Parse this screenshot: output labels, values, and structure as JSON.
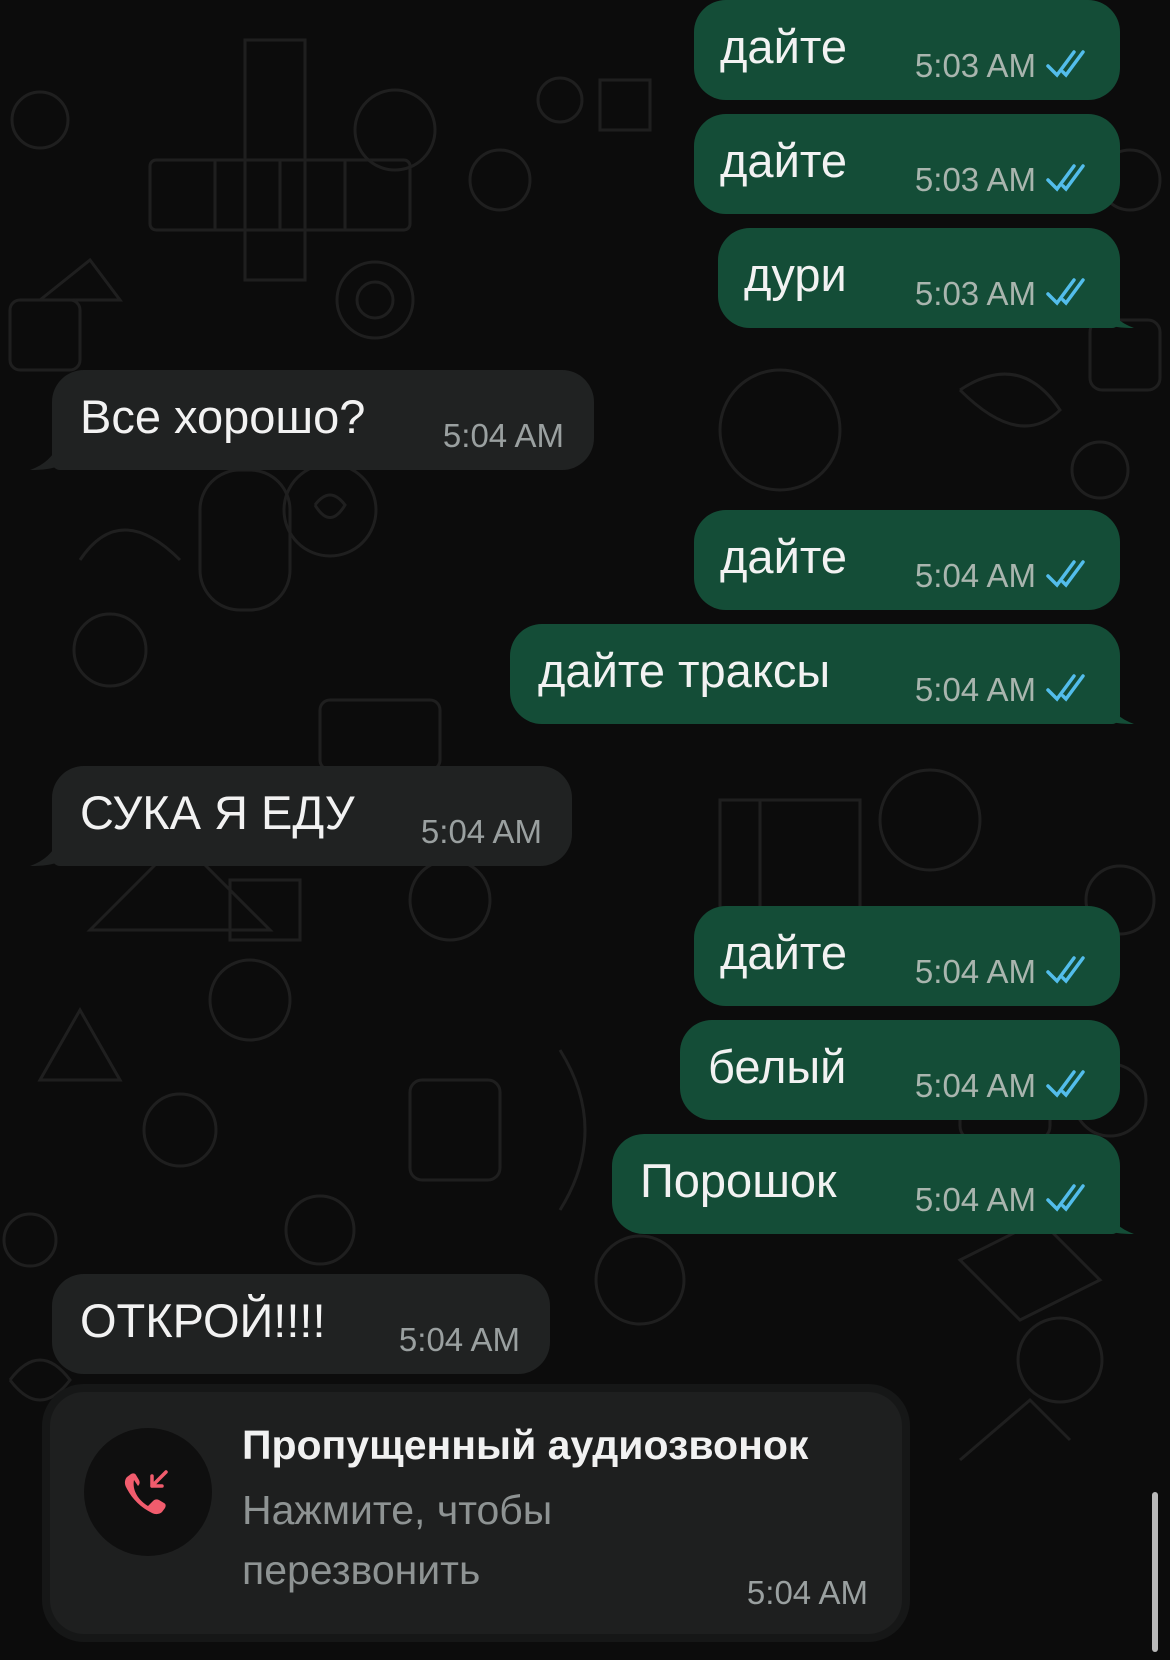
{
  "chat": {
    "messages": [
      {
        "direction": "out",
        "text": "дайте",
        "time": "5:03 AM",
        "status": "read"
      },
      {
        "direction": "out",
        "text": "дайте",
        "time": "5:03 AM",
        "status": "read"
      },
      {
        "direction": "out",
        "text": "дури",
        "time": "5:03 AM",
        "status": "read"
      },
      {
        "direction": "in",
        "text": "Все хорошо?",
        "time": "5:04 AM"
      },
      {
        "direction": "out",
        "text": "дайте",
        "time": "5:04 AM",
        "status": "read"
      },
      {
        "direction": "out",
        "text": "дайте траксы",
        "time": "5:04 AM",
        "status": "read"
      },
      {
        "direction": "in",
        "text": "СУКА Я ЕДУ",
        "time": "5:04 AM"
      },
      {
        "direction": "out",
        "text": "дайте",
        "time": "5:04 AM",
        "status": "read"
      },
      {
        "direction": "out",
        "text": "белый",
        "time": "5:04 AM",
        "status": "read"
      },
      {
        "direction": "out",
        "text": "Порошок",
        "time": "5:04 AM",
        "status": "read"
      },
      {
        "direction": "in",
        "text": "ОТКРОЙ!!!!",
        "time": "5:04 AM"
      }
    ],
    "missed_call": {
      "title": "Пропущенный аудиозвонок",
      "subtitle": "Нажмите, чтобы перезвонить",
      "time": "5:04 AM",
      "icon": "missed-call-icon"
    }
  },
  "colors": {
    "outgoing_bubble": "#144d37",
    "incoming_bubble": "#202222",
    "read_ticks": "#53bdeb",
    "missed_call_red": "#f15c6d"
  }
}
